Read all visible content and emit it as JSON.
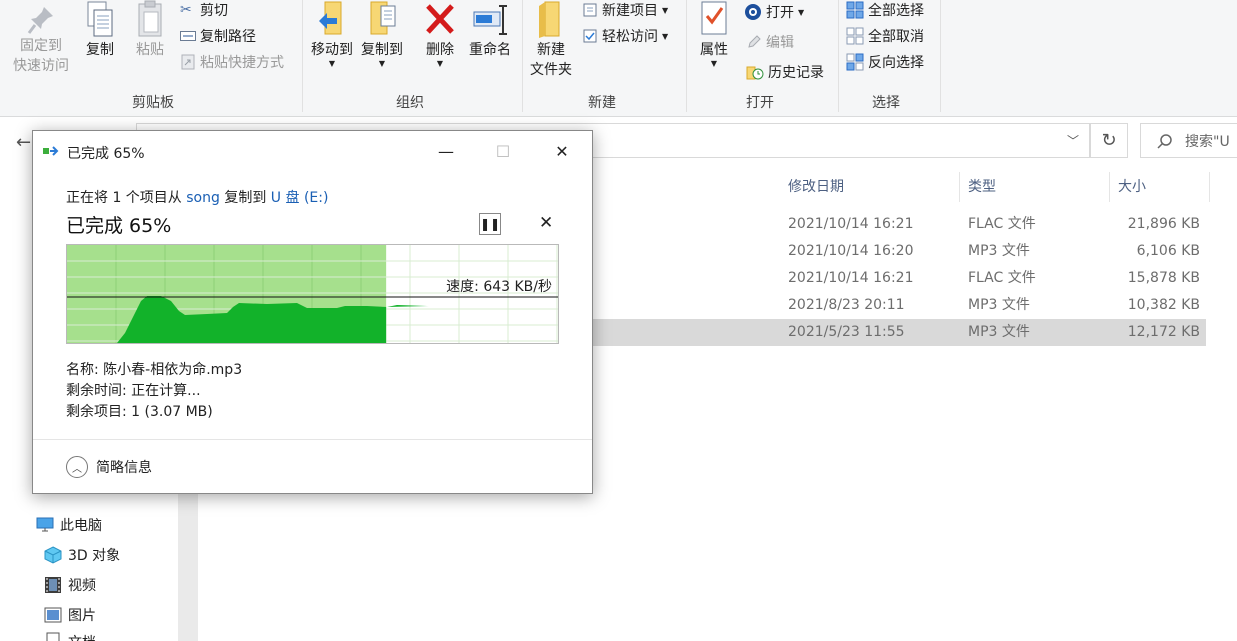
{
  "ribbon": {
    "clipboard": {
      "pin_label_1": "固定到",
      "pin_label_2": "快速访问",
      "copy": "复制",
      "paste": "粘贴",
      "cut": "剪切",
      "copy_path": "复制路径",
      "paste_shortcut": "粘贴快捷方式",
      "group": "剪贴板"
    },
    "organize": {
      "move_to": "移动到",
      "copy_to": "复制到",
      "delete": "删除",
      "rename": "重命名",
      "group": "组织"
    },
    "new": {
      "new_folder_1": "新建",
      "new_folder_2": "文件夹",
      "new_item": "新建项目",
      "easy_access": "轻松访问",
      "group": "新建"
    },
    "open": {
      "properties": "属性",
      "open": "打开",
      "edit": "编辑",
      "history": "历史记录",
      "group": "打开"
    },
    "select": {
      "select_all": "全部选择",
      "select_none": "全部取消",
      "invert": "反向选择",
      "group": "选择"
    }
  },
  "address": {
    "search_placeholder": "搜索\"U"
  },
  "columns": {
    "modified": "修改日期",
    "type": "类型",
    "size": "大小"
  },
  "files": [
    {
      "date": "2021/10/14 16:21",
      "type": "FLAC 文件",
      "size": "21,896 KB"
    },
    {
      "date": "2021/10/14 16:20",
      "type": "MP3 文件",
      "size": "6,106 KB"
    },
    {
      "date": "2021/10/14 16:21",
      "type": "FLAC 文件",
      "size": "15,878 KB"
    },
    {
      "date": "2021/8/23 20:11",
      "type": "MP3 文件",
      "size": "10,382 KB"
    },
    {
      "date": "2021/5/23 11:55",
      "type": "MP3 文件",
      "size": "12,172 KB"
    }
  ],
  "nav": {
    "this_pc": "此电脑",
    "objects_3d": "3D 对象",
    "videos": "视频",
    "pictures": "图片",
    "documents": "文档"
  },
  "dialog": {
    "title": "已完成 65%",
    "copy_prefix": "正在将 1 个项目从 ",
    "source": "song",
    "copy_mid": " 复制到 ",
    "dest": "U 盘 (E:)",
    "progress_text": "已完成 65%",
    "progress": 0.65,
    "speed": "速度: 643 KB/秒",
    "name_line": "名称: 陈小春-相依为命.mp3",
    "time_line": "剩余时间: 正在计算...",
    "items_line": "剩余项目: 1 (3.07 MB)",
    "less_details": "简略信息"
  },
  "colors": {
    "progress_fill": "#a6e08d",
    "speed_fill": "#12b22a",
    "accent": "#1a5fb4"
  }
}
